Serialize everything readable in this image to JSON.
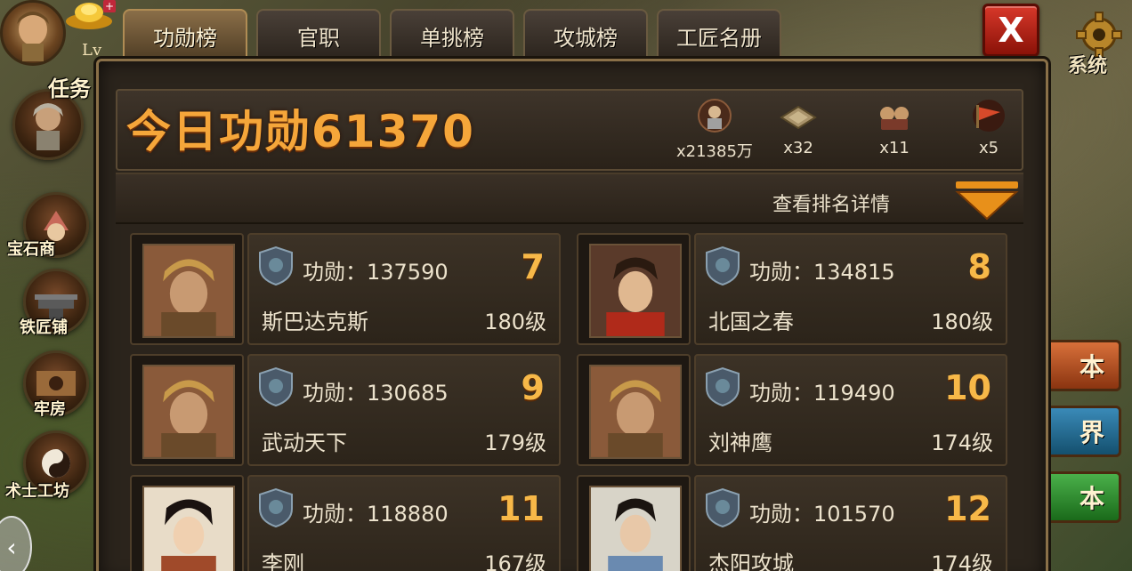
{
  "tabs": [
    "功勋榜",
    "官职",
    "单挑榜",
    "攻城榜",
    "工匠名册"
  ],
  "close_label": "X",
  "settings_label": "系统",
  "left": {
    "lv_text": "Lv",
    "task_label": "任务",
    "gem_shop_label": "宝石商",
    "blacksmith_label": "铁匠铺",
    "prison_label": "牢房",
    "taoist_label": "术士工坊",
    "scroll_arrow": "‹"
  },
  "right": {
    "btn1": "本",
    "btn2": "界",
    "btn3": "本"
  },
  "header": {
    "today_label": "今日功勋",
    "today_value": "61370",
    "rewards": [
      {
        "icon": "soldier-icon",
        "count": "x21385万"
      },
      {
        "icon": "fortress-icon",
        "count": "x32"
      },
      {
        "icon": "troops-icon",
        "count": "x11"
      },
      {
        "icon": "war-flag-icon",
        "count": "x5"
      }
    ]
  },
  "detail_label": "查看排名详情",
  "merit_prefix": "功勋：",
  "ranks": [
    {
      "rank": "7",
      "merit": "137590",
      "name": "斯巴达克斯",
      "level": "180级",
      "portrait": "helmet-general"
    },
    {
      "rank": "8",
      "merit": "134815",
      "name": "北国之春",
      "level": "180级",
      "portrait": "young-warrior"
    },
    {
      "rank": "9",
      "merit": "130685",
      "name": "武动天下",
      "level": "179级",
      "portrait": "helmet-general"
    },
    {
      "rank": "10",
      "merit": "119490",
      "name": "刘神鹰",
      "level": "174级",
      "portrait": "helmet-general"
    },
    {
      "rank": "11",
      "merit": "118880",
      "name": "李刚",
      "level": "167级",
      "portrait": "female-warrior"
    },
    {
      "rank": "12",
      "merit": "101570",
      "name": "杰阳攻城",
      "level": "174级",
      "portrait": "scholar"
    }
  ],
  "colors": {
    "rank_gold": "#f7b848",
    "title_orange": "#f5a63a",
    "close_red": "#d8382a"
  }
}
